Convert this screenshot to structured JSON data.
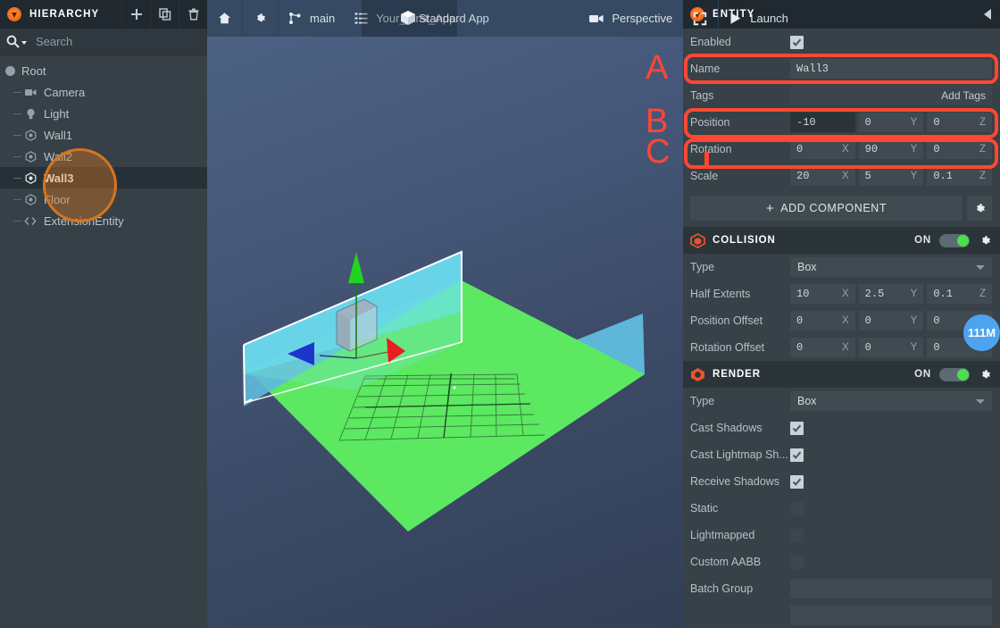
{
  "hierarchy": {
    "title": "HIERARCHY",
    "logo_icon": "playcanvas-logo-icon",
    "actions": [
      {
        "name": "add-entity-button",
        "icon": "plus-icon",
        "label": "+"
      },
      {
        "name": "duplicate-entity-button",
        "icon": "copy-icon",
        "label": ""
      },
      {
        "name": "delete-entity-button",
        "icon": "trash-icon",
        "label": ""
      }
    ],
    "search": {
      "placeholder": "Search",
      "value": ""
    },
    "items": [
      {
        "label": "Root",
        "icon": "root-dot-icon",
        "depth": 0,
        "selected": false
      },
      {
        "label": "Camera",
        "icon": "camera-icon",
        "depth": 1,
        "selected": false
      },
      {
        "label": "Light",
        "icon": "light-bulb-icon",
        "depth": 1,
        "selected": false
      },
      {
        "label": "Wall1",
        "icon": "entity-icon",
        "depth": 1,
        "selected": false
      },
      {
        "label": "Wall2",
        "icon": "entity-icon",
        "depth": 1,
        "selected": false
      },
      {
        "label": "Wall3",
        "icon": "entity-icon",
        "depth": 1,
        "selected": true
      },
      {
        "label": "Floor",
        "icon": "entity-icon",
        "depth": 1,
        "selected": false
      },
      {
        "label": "ExtensionEntity",
        "icon": "script-brackets-icon",
        "depth": 1,
        "selected": false
      }
    ]
  },
  "toolbar": {
    "home_icon": "home-icon",
    "settings_icon": "gear-icon",
    "branch_icon": "branch-icon",
    "branch_label": "main",
    "scene_list_icon": "list-icon",
    "scene_label": "Your_First_App",
    "overlap_label": "Standard App",
    "overlap_cube_icon": "cube-icon",
    "camera_icon": "camera-icon",
    "camera_label": "Perspective",
    "fullscreen_icon": "fullscreen-icon",
    "play_icon": "play-icon",
    "launch_label": "Launch"
  },
  "viewport": {
    "gizmo": {
      "y_axis_color": "#22d422",
      "x_axis_color": "#e81f1f",
      "z_axis_color": "#1e35cc"
    },
    "floor_color": "#5ce861",
    "wall_color": "#63c8e6",
    "background_color": "#3b4a66"
  },
  "inspector": {
    "title": "ENTITY",
    "logo_icon": "playcanvas-logo-icon",
    "collapse_icon": "collapse-left-arrow-icon",
    "entity": {
      "enabled_label": "Enabled",
      "enabled_checked": true,
      "name_label": "Name",
      "name_value": "Wall3",
      "tags_label": "Tags",
      "add_tags_label": "Add Tags",
      "position_label": "Position",
      "position": {
        "x": "-10",
        "y": "0",
        "z": "0"
      },
      "rotation_label": "Rotation",
      "rotation": {
        "x": "0",
        "y": "90",
        "z": "0"
      },
      "scale_label": "Scale",
      "scale": {
        "x": "20",
        "y": "5",
        "z": "0.1"
      },
      "axis_x": "X",
      "axis_y": "Y",
      "axis_z": "Z",
      "add_component_label": "ADD COMPONENT",
      "add_component_plus": "+",
      "settings_icon": "gear-icon"
    },
    "collision": {
      "title": "COLLISION",
      "icon": "collision-cube-icon",
      "on_label": "ON",
      "enabled": true,
      "type_label": "Type",
      "type_value": "Box",
      "half_extents_label": "Half Extents",
      "half_extents": {
        "x": "10",
        "y": "2.5",
        "z": "0.1"
      },
      "position_offset_label": "Position Offset",
      "position_offset": {
        "x": "0",
        "y": "0",
        "z": "0"
      },
      "rotation_offset_label": "Rotation Offset",
      "rotation_offset": {
        "x": "0",
        "y": "0",
        "z": "0"
      }
    },
    "render": {
      "title": "RENDER",
      "icon": "render-sphere-icon",
      "on_label": "ON",
      "enabled": true,
      "type_label": "Type",
      "type_value": "Box",
      "cast_shadows_label": "Cast Shadows",
      "cast_shadows": true,
      "cast_lightmap_label": "Cast Lightmap Sh...",
      "cast_lightmap": true,
      "receive_shadows_label": "Receive Shadows",
      "receive_shadows": true,
      "static_label": "Static",
      "static": false,
      "lightmapped_label": "Lightmapped",
      "lightmapped": false,
      "custom_aabb_label": "Custom AABB",
      "custom_aabb": false,
      "batch_group_label": "Batch Group",
      "batch_group_value": ""
    }
  },
  "annotations": {
    "letters": [
      {
        "text": "A",
        "target": "name-field"
      },
      {
        "text": "B",
        "target": "position-field"
      },
      {
        "text": "C",
        "target": "rotation-field"
      }
    ],
    "badge": {
      "text": "111M",
      "color": "#4ea3f0"
    },
    "highlight_color": "#ff4733",
    "circle_color": "#d4751f"
  }
}
